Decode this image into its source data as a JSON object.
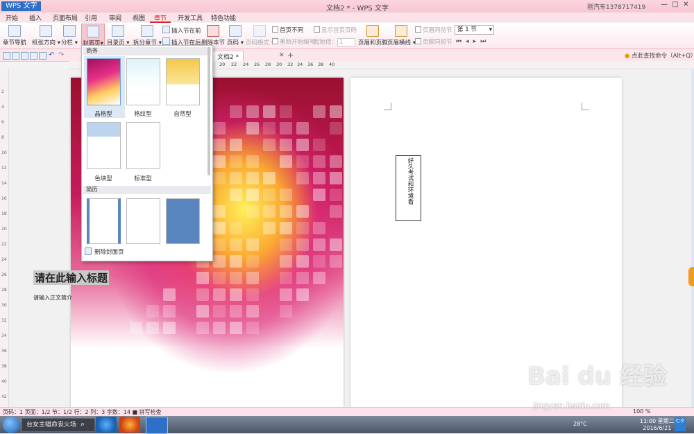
{
  "app": {
    "badge": "WPS 文字",
    "title": "文档2 * - WPS 文字",
    "user": "刚汽车1378717419"
  },
  "menu": [
    "开始",
    "插入",
    "页面布局",
    "引用",
    "审阅",
    "视图",
    "章节",
    "开发工具",
    "特色功能"
  ],
  "ribbon": {
    "nav": "章节导航",
    "orientation": "纸张方向",
    "columns": "分栏",
    "cover": "封面页",
    "toc": "目录页",
    "split": "拆分章节",
    "insert_before": "插入节在前",
    "insert_after": "插入节在后",
    "delete_section": "删除本节",
    "page_num": "页码",
    "page_num_format": "页码格式",
    "diff_first": "首页不同",
    "show_first_num": "显示首页页码",
    "restart_num": "重新开始编号",
    "start_value_label": "起始值：",
    "start_value": "1",
    "header_footer": "页眉和页脚",
    "header_line": "页眉横线",
    "same_prev1": "页眉同前节",
    "same_prev2": "页脚同前节",
    "section_combo": "第 1 节"
  },
  "tab": {
    "doc": "文档2 *"
  },
  "search_cmd": "点此查找命令（Alt+Q）",
  "ruler": {
    "h": [
      "20",
      "22",
      "24",
      "26",
      "28",
      "30",
      "32",
      "34",
      "36",
      "38",
      "40"
    ],
    "v": [
      "2",
      "4",
      "6",
      "8",
      "10",
      "12",
      "14",
      "16",
      "18",
      "20",
      "22",
      "24",
      "26",
      "28",
      "30",
      "32",
      "34",
      "36",
      "38",
      "40",
      "42"
    ]
  },
  "dropdown": {
    "business_header": "商务",
    "business": [
      "晶格型",
      "格纹型",
      "自然型",
      "色块型",
      "标准型"
    ],
    "resume_header": "简历",
    "delete": "删除封面页"
  },
  "cover": {
    "title": "请在此输入标题",
    "intro": "请输入正文简介"
  },
  "textbox": "好久考试和环境看",
  "status": {
    "text": "页码：1  页面：1/2  节：1/2  行：2  列：3  字数：14  ■ 拼写检查",
    "zoom": "100 %"
  },
  "taskbar": {
    "search": "台女主唱命丧火场",
    "temp": "28°C",
    "time": "11:00 星期二",
    "date": "2016/6/21",
    "badge": "七夕"
  },
  "watermark": {
    "main": "Bai du 经验",
    "sub": "jingyan.baidu.com"
  },
  "colors": {
    "accent": "#d02a2a",
    "ribbon_bg": "#fbe3e9",
    "app_blue": "#2e6fc8"
  }
}
